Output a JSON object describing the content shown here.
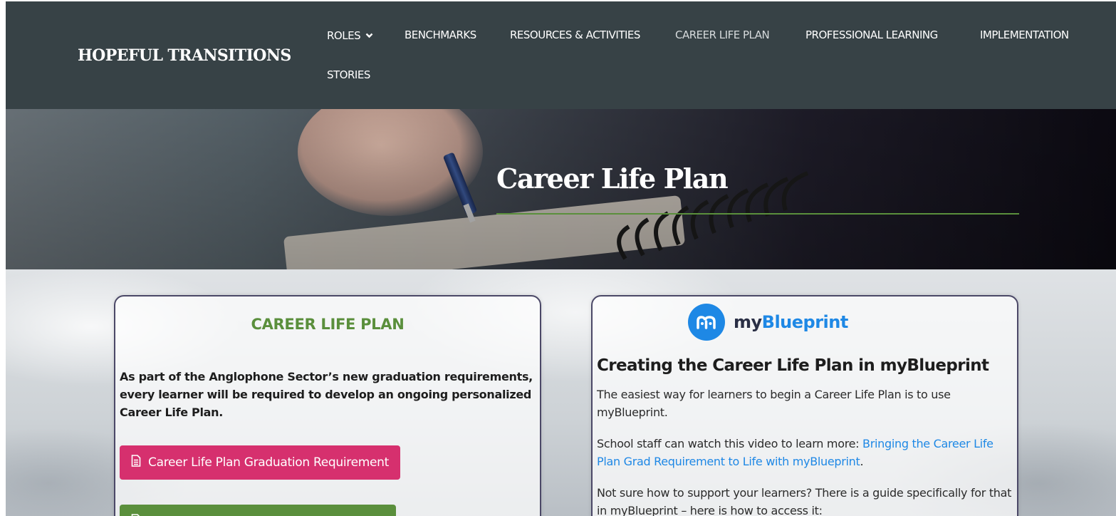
{
  "header": {
    "brand": "HOPEFUL TRANSITIONS",
    "nav": [
      {
        "label": "ROLES",
        "has_dropdown": true
      },
      {
        "label": "BENCHMARKS"
      },
      {
        "label": "RESOURCES & ACTIVITIES"
      },
      {
        "label": "CAREER LIFE PLAN",
        "active": true
      },
      {
        "label": "PROFESSIONAL LEARNING"
      },
      {
        "label": "IMPLEMENTATION"
      },
      {
        "label": "STORIES"
      }
    ]
  },
  "hero": {
    "title": "Career Life Plan"
  },
  "left_card": {
    "title": "CAREER LIFE PLAN",
    "intro": "As part of the Anglophone Sector’s new graduation requirements, every learner will be required to develop an ongoing personalized Career Life Plan.",
    "buttons": [
      {
        "label": "Career Life Plan Graduation Requirement",
        "color": "#d6306e",
        "icon": "document-icon"
      },
      {
        "label": "",
        "color": "#5a8f3c",
        "icon": "document-icon"
      }
    ]
  },
  "right_card": {
    "logo": {
      "my": "my",
      "blueprint": "Blueprint",
      "color": "#1e88e5"
    },
    "heading": "Creating the Career Life Plan in myBlueprint",
    "p1": "The easiest way for learners to begin a Career Life Plan is to use myBlueprint.",
    "p2_before": "School staff can watch this video to learn more: ",
    "p2_link": "Bringing the Career Life Plan Grad Requirement to Life with myBlueprint",
    "p2_after": ".",
    "p3": "Not sure how to support your learners? There is a guide specifically for that in myBlueprint – here is how to access it:"
  },
  "colors": {
    "header_bg": "#374246",
    "accent_green": "#5a8f3c",
    "accent_pink": "#d6306e",
    "link_blue": "#1e88e5",
    "card_border": "#4b4867"
  }
}
